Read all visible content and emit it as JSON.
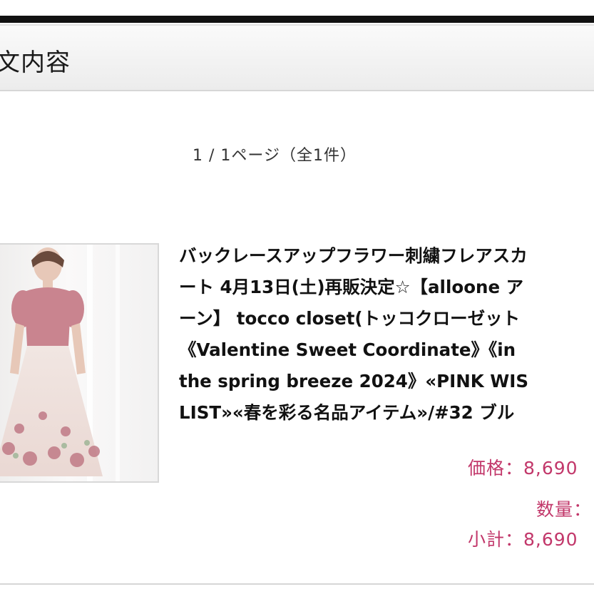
{
  "header": {
    "title": "文内容"
  },
  "pager": {
    "text": "1 / 1ページ（全1件）"
  },
  "product": {
    "name_lines": [
      "バックレースアップフラワー刺繍フレアスカ",
      "ート 4月13日(土)再販決定☆【alloone ア",
      "ーン】 tocco closet(トッコクローゼット",
      "《Valentine Sweet Coordinate》《in",
      "the spring breeze 2024》«PINK WIS",
      "LIST»«春を彩る名品アイテム»/#32 ブル"
    ],
    "price": "価格：8,690",
    "quantity": "数量：",
    "subtotal": "小計：8,690"
  },
  "colors": {
    "accent_price": "#c2376a",
    "header_bg": "#f0f0f0",
    "top_bar": "#111111"
  }
}
